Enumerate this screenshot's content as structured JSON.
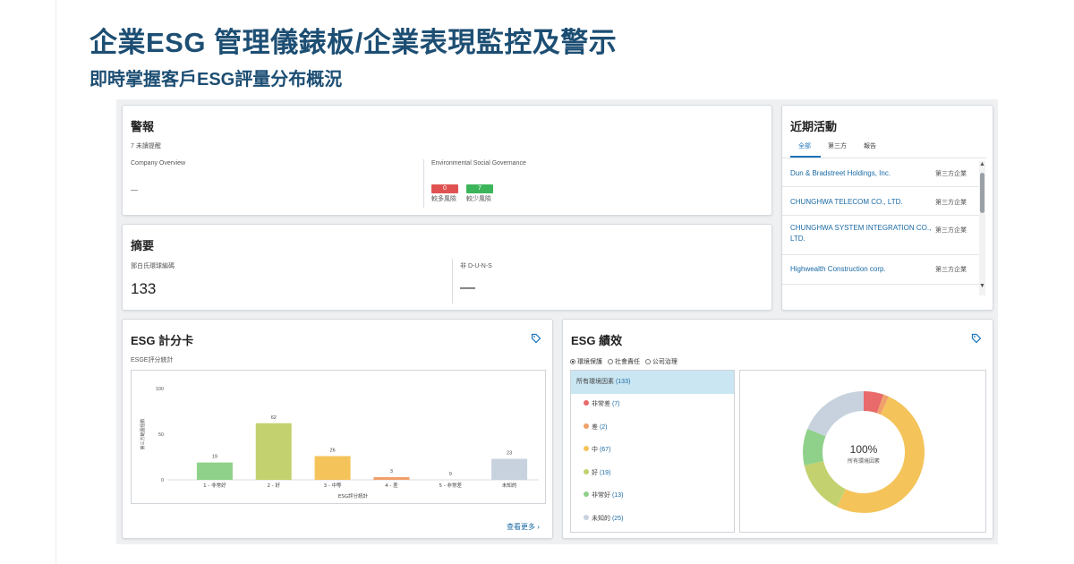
{
  "header": {
    "title": "企業ESG 管理儀錶板/企業表現監控及警示",
    "subtitle": "即時掌握客戶ESG評量分布概況"
  },
  "alerts": {
    "title": "警報",
    "unread": "7 未讀提醒",
    "col1_label": "Company Overview",
    "col1_value": "—",
    "col2_label": "Environmental Social Governance",
    "badge_more": {
      "value": "0",
      "label": "較多風險",
      "color": "#e05252"
    },
    "badge_less": {
      "value": "7",
      "label": "較少風險",
      "color": "#3cb55a"
    }
  },
  "summary": {
    "title": "摘要",
    "col1_label": "鄧白氏環球編碼",
    "col1_value": "133",
    "col2_label": "非 D-U-N-S",
    "col2_value": "—"
  },
  "activity": {
    "title": "近期活動",
    "tabs": [
      "全部",
      "第三方",
      "報告"
    ],
    "items": [
      {
        "name": "Dun & Bradstreet Holdings, Inc.",
        "type": "第三方企業"
      },
      {
        "name": "CHUNGHWA TELECOM CO., LTD.",
        "type": "第三方企業"
      },
      {
        "name": "CHUNGHWA SYSTEM INTEGRATION CO., LTD.",
        "type": "第三方企業"
      },
      {
        "name": "Highwealth Construction corp.",
        "type": "第三方企業"
      }
    ]
  },
  "scorecard": {
    "title": "ESG 計分卡",
    "subtitle": "ESGE評分統計",
    "more_link": "查看更多 ›",
    "chart_data": {
      "type": "bar",
      "categories": [
        "1 - 非常好",
        "2 - 好",
        "3 - 中等",
        "4 - 差",
        "5 - 非常差",
        "未知的"
      ],
      "values": [
        19,
        62,
        26,
        3,
        0,
        23
      ],
      "colors": [
        "#8fd18a",
        "#c3d16f",
        "#f4c35a",
        "#f0a06a",
        "#e86a6a",
        "#c7d2de"
      ],
      "ylabel": "第三方範圍個數",
      "xlabel": "ESG評分統計",
      "yticks": [
        0,
        50,
        100
      ],
      "ylim": [
        0,
        100
      ]
    }
  },
  "performance": {
    "title": "ESG 績效",
    "radios": [
      {
        "label": "環境保護",
        "selected": true
      },
      {
        "label": "社會責任",
        "selected": false
      },
      {
        "label": "公司治理",
        "selected": false
      }
    ],
    "legend": [
      {
        "label": "所有環境因素",
        "count": "(133)",
        "color": "",
        "selected": true
      },
      {
        "label": "非常差",
        "count": "(7)",
        "color": "#e86a6a"
      },
      {
        "label": "差",
        "count": "(2)",
        "color": "#f0a06a"
      },
      {
        "label": "中",
        "count": "(67)",
        "color": "#f4c35a"
      },
      {
        "label": "好",
        "count": "(19)",
        "color": "#c3d16f"
      },
      {
        "label": "非常好",
        "count": "(13)",
        "color": "#8fd18a"
      },
      {
        "label": "未知的",
        "count": "(25)",
        "color": "#c7d2de"
      }
    ],
    "donut_center_value": "100%",
    "donut_center_label": "所有環境因素",
    "chart_data": {
      "type": "pie",
      "labels": [
        "非常差",
        "差",
        "中",
        "好",
        "非常好",
        "未知的"
      ],
      "values": [
        7,
        2,
        67,
        19,
        13,
        25
      ],
      "colors": [
        "#e86a6a",
        "#f0a06a",
        "#f4c35a",
        "#c3d16f",
        "#8fd18a",
        "#c7d2de"
      ]
    }
  }
}
